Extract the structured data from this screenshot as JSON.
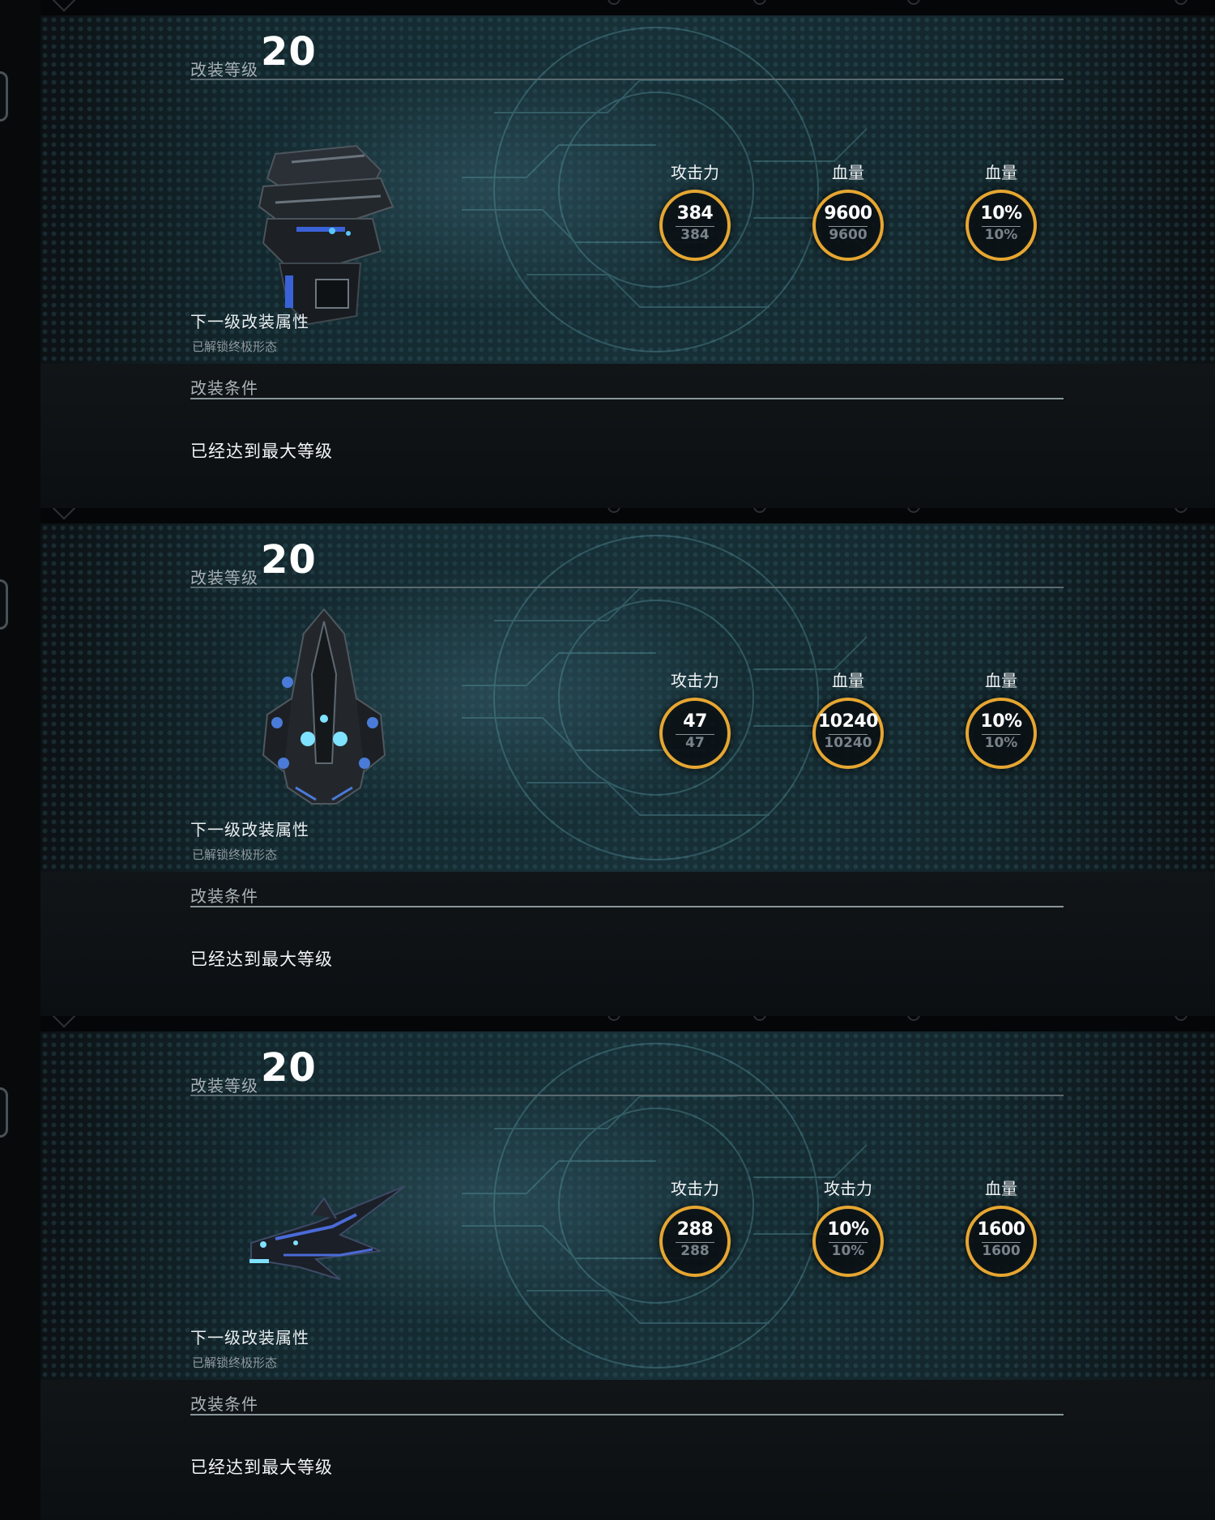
{
  "panels": [
    {
      "level_label": "改装等级",
      "level_value": "20",
      "next_attr_label": "下一级改装属性",
      "unlocked_text": "已解锁终极形态",
      "condition_label": "改装条件",
      "condition_value": "已经达到最大等级",
      "ship_icon": "heavy-battleship-icon",
      "stats": [
        {
          "label": "攻击力",
          "current": "384",
          "next": "384"
        },
        {
          "label": "血量",
          "current": "9600",
          "next": "9600"
        },
        {
          "label": "血量",
          "current": "10%",
          "next": "10%"
        }
      ]
    },
    {
      "level_label": "改装等级",
      "level_value": "20",
      "next_attr_label": "下一级改装属性",
      "unlocked_text": "已解锁终极形态",
      "condition_label": "改装条件",
      "condition_value": "已经达到最大等级",
      "ship_icon": "cruiser-ship-icon",
      "stats": [
        {
          "label": "攻击力",
          "current": "47",
          "next": "47"
        },
        {
          "label": "血量",
          "current": "10240",
          "next": "10240"
        },
        {
          "label": "血量",
          "current": "10%",
          "next": "10%"
        }
      ]
    },
    {
      "level_label": "改装等级",
      "level_value": "20",
      "next_attr_label": "下一级改装属性",
      "unlocked_text": "已解锁终极形态",
      "condition_label": "改装条件",
      "condition_value": "已经达到最大等级",
      "ship_icon": "fighter-ship-icon",
      "stats": [
        {
          "label": "攻击力",
          "current": "288",
          "next": "288"
        },
        {
          "label": "攻击力",
          "current": "10%",
          "next": "10%"
        },
        {
          "label": "血量",
          "current": "1600",
          "next": "1600"
        }
      ]
    }
  ],
  "colors": {
    "ring": "#e6a631",
    "background": "#07090b",
    "panel_glow": "#183139"
  }
}
